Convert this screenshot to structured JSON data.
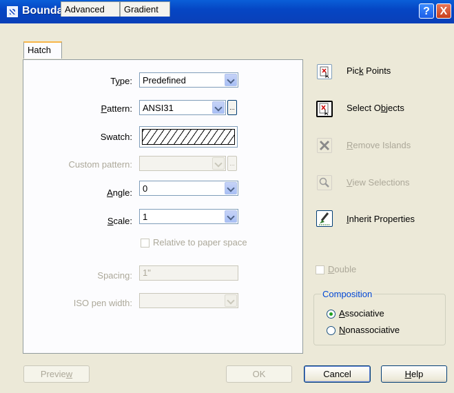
{
  "window": {
    "title": "Boundary Hatch and Fill",
    "help_glyph": "?",
    "close_glyph": "X"
  },
  "tabs": [
    "Hatch",
    "Advanced",
    "Gradient"
  ],
  "hatch": {
    "type_label": "Type:",
    "type_value": "Predefined",
    "pattern_label": "Pattern:",
    "pattern_value": "ANSI31",
    "pattern_browse": "...",
    "swatch_label": "Swatch:",
    "custom_pattern_label": "Custom pattern:",
    "custom_pattern_browse": "...",
    "angle_label": "Angle:",
    "angle_value": "0",
    "scale_label": "Scale:",
    "scale_value": "1",
    "relative_label": "Relative to paper space",
    "spacing_label": "Spacing:",
    "spacing_value": "1\"",
    "iso_pen_label": "ISO pen width:"
  },
  "side": {
    "pick_points": "Pick Points",
    "select_objects": "Select Objects",
    "remove_islands": "Remove Islands",
    "view_selections": "View Selections",
    "inherit_properties": "Inherit Properties",
    "double": "Double"
  },
  "composition": {
    "legend": "Composition",
    "associative": "Associative",
    "nonassociative": "Nonassociative"
  },
  "buttons": {
    "preview": "Preview",
    "ok": "OK",
    "cancel": "Cancel",
    "help": "Help"
  }
}
